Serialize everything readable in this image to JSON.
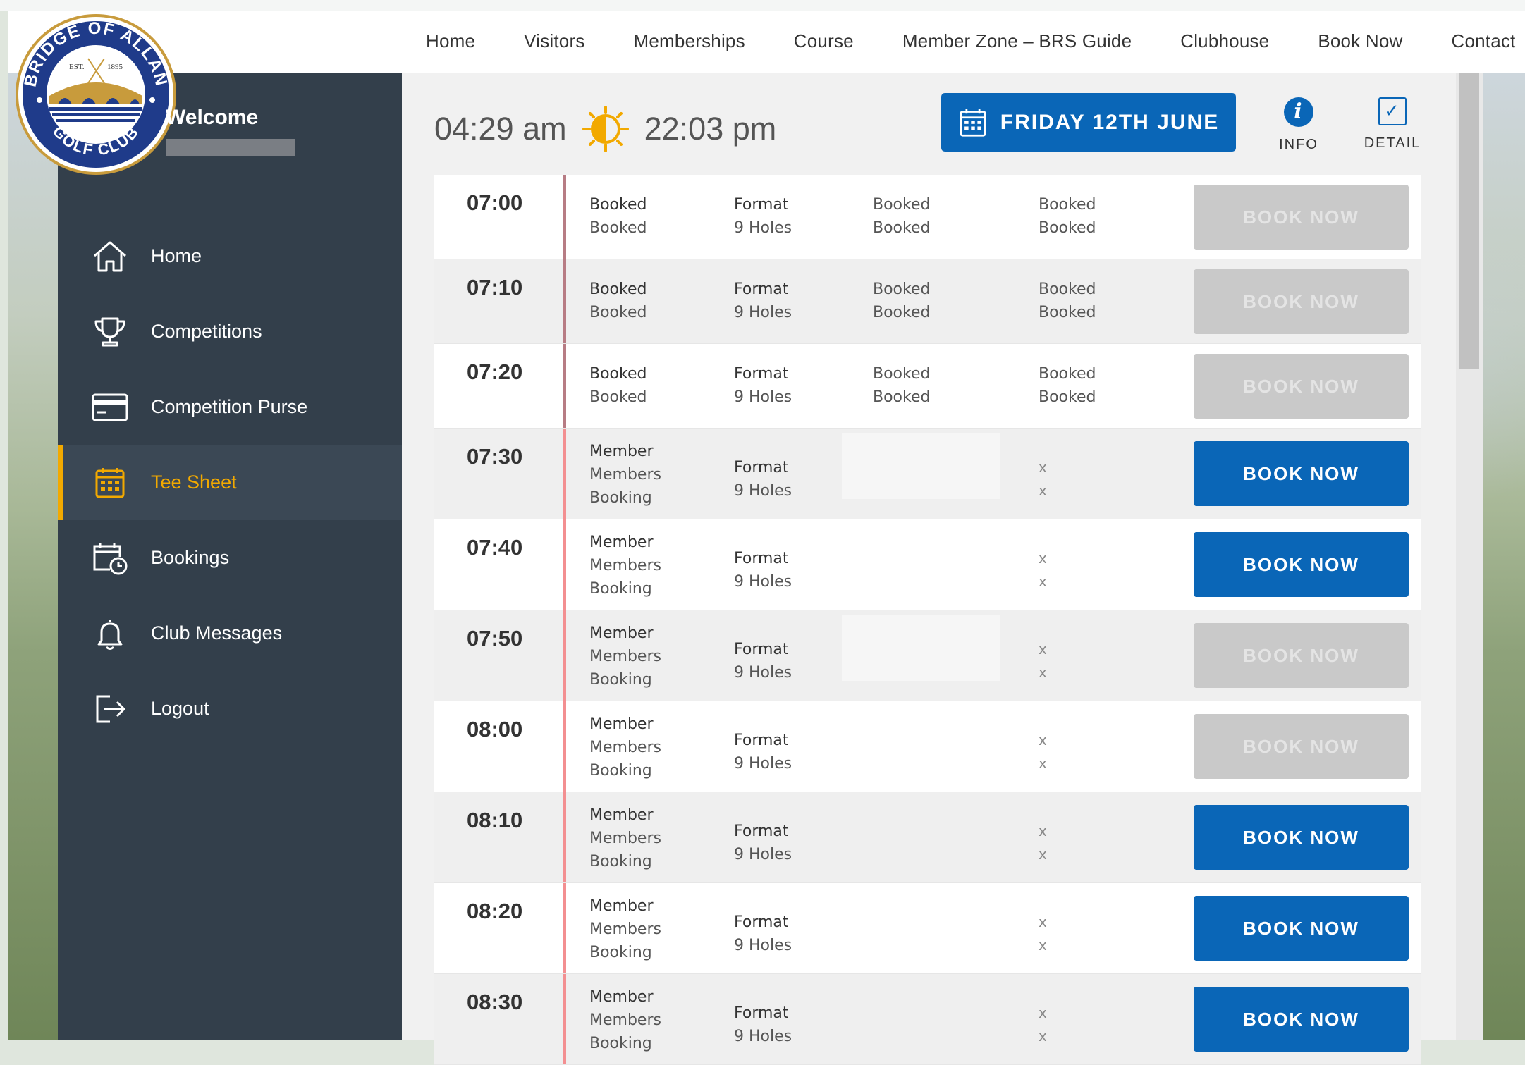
{
  "nav": [
    "Home",
    "Visitors",
    "Memberships",
    "Course",
    "Member Zone – BRS Guide",
    "Clubhouse",
    "Book Now",
    "Contact"
  ],
  "logo": {
    "text_top": "BRIDGE OF ALLAN",
    "text_bottom": "GOLF CLUB",
    "est": "EST.",
    "year": "1895"
  },
  "welcome": {
    "title": "Welcome"
  },
  "menu": [
    {
      "label": "Home",
      "icon": "home-icon"
    },
    {
      "label": "Competitions",
      "icon": "trophy-icon"
    },
    {
      "label": "Competition Purse",
      "icon": "card-icon"
    },
    {
      "label": "Tee Sheet",
      "icon": "calendar-grid-icon",
      "active": true
    },
    {
      "label": "Bookings",
      "icon": "calendar-clock-icon"
    },
    {
      "label": "Club Messages",
      "icon": "bell-icon"
    },
    {
      "label": "Logout",
      "icon": "logout-icon"
    }
  ],
  "header": {
    "sunrise": "04:29 am",
    "sunset": "22:03 pm",
    "date": "FRIDAY 12TH JUNE",
    "info": "INFO",
    "detail": "DETAIL"
  },
  "colors": {
    "accent": "#0a66b7",
    "active": "#f2a900",
    "sidebar": "#333f4b"
  },
  "rows": [
    {
      "time": "07:00",
      "kind": "booked",
      "c1": [
        "Booked",
        "Booked"
      ],
      "c2": [
        "Format",
        "9 Holes"
      ],
      "c3": [
        "Booked",
        "Booked"
      ],
      "c4": [
        "Booked",
        "Booked"
      ],
      "button": "BOOK NOW",
      "enabled": false
    },
    {
      "time": "07:10",
      "kind": "booked",
      "c1": [
        "Booked",
        "Booked"
      ],
      "c2": [
        "Format",
        "9 Holes"
      ],
      "c3": [
        "Booked",
        "Booked"
      ],
      "c4": [
        "Booked",
        "Booked"
      ],
      "button": "BOOK NOW",
      "enabled": false
    },
    {
      "time": "07:20",
      "kind": "booked",
      "c1": [
        "Booked",
        "Booked"
      ],
      "c2": [
        "Format",
        "9 Holes"
      ],
      "c3": [
        "Booked",
        "Booked"
      ],
      "c4": [
        "Booked",
        "Booked"
      ],
      "button": "BOOK NOW",
      "enabled": false
    },
    {
      "time": "07:30",
      "kind": "open",
      "c1": [
        "Member",
        "Members",
        "Booking"
      ],
      "c2": [
        "Format",
        "9 Holes"
      ],
      "x": [
        "x",
        "x"
      ],
      "blank": true,
      "button": "BOOK NOW",
      "enabled": true
    },
    {
      "time": "07:40",
      "kind": "open",
      "c1": [
        "Member",
        "Members",
        "Booking"
      ],
      "c2": [
        "Format",
        "9 Holes"
      ],
      "x": [
        "x",
        "x"
      ],
      "blank": false,
      "button": "BOOK NOW",
      "enabled": true
    },
    {
      "time": "07:50",
      "kind": "open",
      "c1": [
        "Member",
        "Members",
        "Booking"
      ],
      "c2": [
        "Format",
        "9 Holes"
      ],
      "x": [
        "x",
        "x"
      ],
      "blank": true,
      "button": "BOOK NOW",
      "enabled": false
    },
    {
      "time": "08:00",
      "kind": "open",
      "c1": [
        "Member",
        "Members",
        "Booking"
      ],
      "c2": [
        "Format",
        "9 Holes"
      ],
      "x": [
        "x",
        "x"
      ],
      "blank": false,
      "button": "BOOK NOW",
      "enabled": false
    },
    {
      "time": "08:10",
      "kind": "open",
      "c1": [
        "Member",
        "Members",
        "Booking"
      ],
      "c2": [
        "Format",
        "9 Holes"
      ],
      "x": [
        "x",
        "x"
      ],
      "blank": false,
      "button": "BOOK NOW",
      "enabled": true
    },
    {
      "time": "08:20",
      "kind": "open",
      "c1": [
        "Member",
        "Members",
        "Booking"
      ],
      "c2": [
        "Format",
        "9 Holes"
      ],
      "x": [
        "x",
        "x"
      ],
      "blank": false,
      "button": "BOOK NOW",
      "enabled": true
    },
    {
      "time": "08:30",
      "kind": "open",
      "c1": [
        "Member",
        "Members",
        "Booking"
      ],
      "c2": [
        "Format",
        "9 Holes"
      ],
      "x": [
        "x",
        "x"
      ],
      "blank": false,
      "button": "BOOK NOW",
      "enabled": true
    }
  ]
}
